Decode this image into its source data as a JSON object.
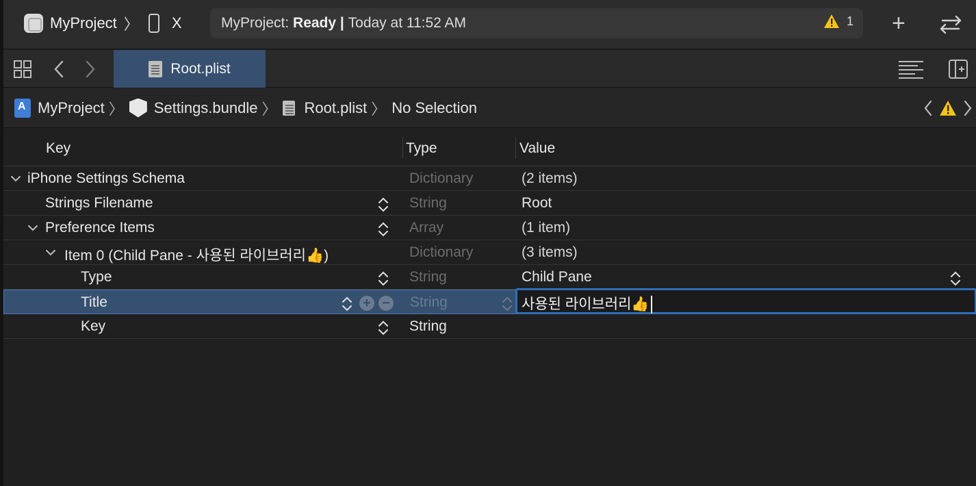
{
  "toolbar": {
    "scheme_name": "MyProject",
    "device_name": "X",
    "status_project": "MyProject:",
    "status_state": "Ready",
    "status_separator": "|",
    "status_time": "Today at 11:52 AM",
    "warning_count": "1"
  },
  "tabs": [
    {
      "label": "Root.plist",
      "active": true
    }
  ],
  "jumpbar": {
    "items": [
      {
        "label": "MyProject",
        "icon": "project-icon"
      },
      {
        "label": "Settings.bundle",
        "icon": "bundle-icon"
      },
      {
        "label": "Root.plist",
        "icon": "plist-file-icon"
      },
      {
        "label": "No Selection",
        "icon": ""
      }
    ]
  },
  "plist": {
    "columns": {
      "key": "Key",
      "type": "Type",
      "value": "Value"
    },
    "rows": [
      {
        "key": "iPhone Settings Schema",
        "type": "Dictionary",
        "value": "(2 items)",
        "expanded": true
      },
      {
        "key": "Strings Filename",
        "type": "String",
        "value": "Root"
      },
      {
        "key": "Preference Items",
        "type": "Array",
        "value": "(1 item)",
        "expanded": true
      },
      {
        "key": "Item 0 (Child Pane - 사용된 라이브러리👍)",
        "type": "Dictionary",
        "value": "(3 items)",
        "expanded": true
      },
      {
        "key": "Type",
        "type": "String",
        "value": "Child Pane"
      },
      {
        "key": "Title",
        "type": "String",
        "value": "사용된 라이브러리👍",
        "selected": true,
        "editing": true
      },
      {
        "key": "Key",
        "type": "String",
        "value": ""
      }
    ]
  },
  "colors": {
    "accent": "#2f6fb8",
    "selection": "#36506f",
    "warning": "#f5c518"
  }
}
